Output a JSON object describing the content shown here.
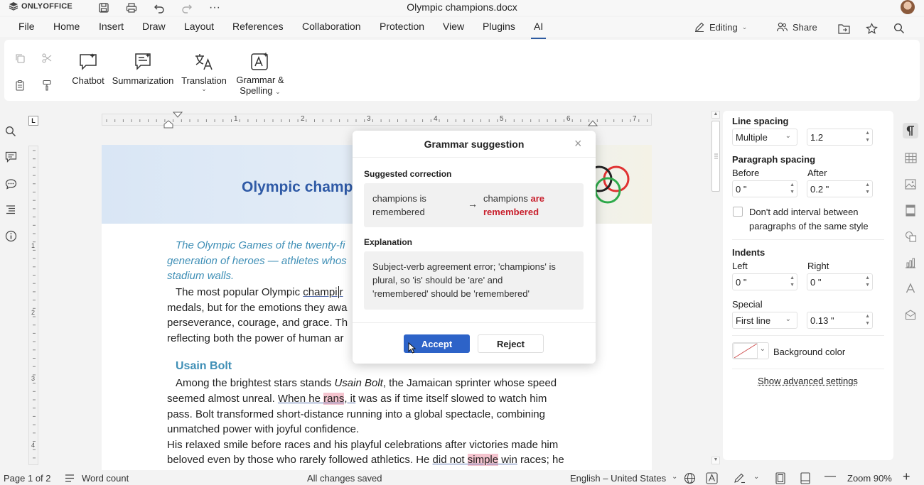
{
  "app": {
    "logo": "ONLYOFFICE",
    "doc_title": "Olympic champions.docx"
  },
  "menu": [
    "File",
    "Home",
    "Insert",
    "Draw",
    "Layout",
    "References",
    "Collaboration",
    "Protection",
    "View",
    "Plugins",
    "AI"
  ],
  "menu_active": "AI",
  "toolbar_right": {
    "mode": "Editing",
    "share": "Share"
  },
  "ribbon": {
    "chatbot": "Chatbot",
    "summarization": "Summarization",
    "translation": "Translation",
    "grammar_line1": "Grammar &",
    "grammar_line2": "Spelling"
  },
  "ruler": {
    "ticks": [
      "1",
      "2",
      "3",
      "4",
      "5",
      "6",
      "7"
    ],
    "vticks": [
      "1",
      "2",
      "3",
      "4"
    ]
  },
  "document": {
    "title": "Olympic champ",
    "intro": [
      "The Olympic Games of the twenty-fi",
      "generation of heroes — athletes whos",
      "stadium walls."
    ],
    "para1": {
      "l1a": "The most popular Olympic ",
      "l1b": "champi",
      "l1c": "r",
      "l2": "medals, but for the emotions they awa",
      "l3": "perseverance, courage, and grace. Th",
      "l4": "reflecting both the power of human ar"
    },
    "heading": "Usain Bolt",
    "para2": {
      "l1a": "Among the brightest stars stands ",
      "l1b": "Usain Bolt",
      "l1c": ", the Jamaican sprinter whose speed",
      "l2a": "seemed almost unreal. ",
      "l2b": "When he ",
      "l2c": "rans",
      "l2d": ", it",
      "l2e": " was as if time itself slowed to watch him",
      "l3": "pass. Bolt transformed short-distance running into a global spectacle, combining",
      "l4": "unmatched power with joyful confidence.",
      "l5": "His relaxed smile before races and his playful celebrations after victories made him",
      "l6a": "beloved even by those who rarely followed athletics. He ",
      "l6b": "did not ",
      "l6c": "simple",
      "l6d": " win",
      "l6e": " races; he"
    }
  },
  "dialog": {
    "title": "Grammar suggestion",
    "suggested_label": "Suggested correction",
    "original_l1": "champions is",
    "original_l2": "remembered",
    "corrected_a": "champions ",
    "corrected_b": "are",
    "corrected_c": "remembered",
    "explanation_label": "Explanation",
    "explanation": [
      "Subject-verb agreement error; 'champions' is",
      "plural, so 'is' should be 'are' and",
      "'remembered' should be 'remembered'"
    ],
    "accept": "Accept",
    "reject": "Reject"
  },
  "panel": {
    "line_spacing": "Line spacing",
    "ls_type": "Multiple",
    "ls_value": "1.2",
    "paragraph_spacing": "Paragraph spacing",
    "before": "Before",
    "after": "After",
    "before_value": "0 \"",
    "after_value": "0.2 \"",
    "no_interval_l1": "Don't add interval between",
    "no_interval_l2": "paragraphs of the same style",
    "indents": "Indents",
    "left": "Left",
    "right": "Right",
    "left_value": "0 \"",
    "right_value": "0 \"",
    "special": "Special",
    "special_type": "First line",
    "special_value": "0.13 \"",
    "background_color": "Background color",
    "advanced": "Show advanced settings"
  },
  "status": {
    "page": "Page 1 of 2",
    "word_count": "Word count",
    "saved": "All changes saved",
    "language": "English – United States",
    "zoom": "Zoom 90%"
  },
  "colors": {
    "accent": "#2d63c8",
    "title_blue": "#2f5aa6",
    "intro_blue": "#3f8fb6",
    "error_red": "#c8202d",
    "highlight": "#f5c4cf"
  }
}
